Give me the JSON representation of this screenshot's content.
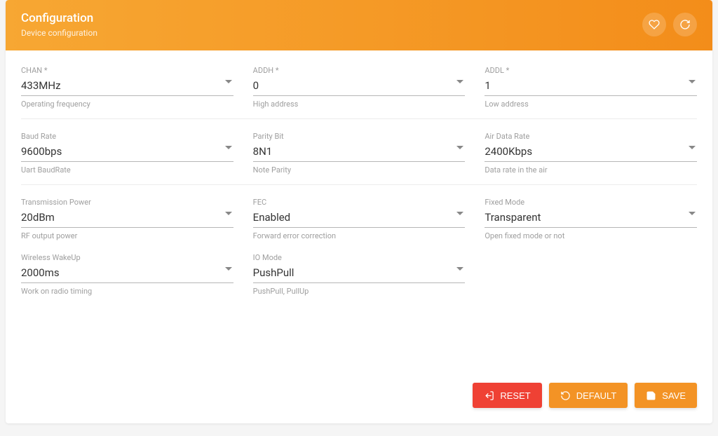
{
  "header": {
    "title": "Configuration",
    "subtitle": "Device configuration"
  },
  "fields": {
    "chan": {
      "label": "CHAN *",
      "value": "433MHz",
      "hint": "Operating frequency"
    },
    "addh": {
      "label": "ADDH *",
      "value": "0",
      "hint": "High address"
    },
    "addl": {
      "label": "ADDL *",
      "value": "1",
      "hint": "Low address"
    },
    "baud": {
      "label": "Baud Rate",
      "value": "9600bps",
      "hint": "Uart BaudRate"
    },
    "parity": {
      "label": "Parity Bit",
      "value": "8N1",
      "hint": "Note Parity"
    },
    "air": {
      "label": "Air Data Rate",
      "value": "2400Kbps",
      "hint": "Data rate in the air"
    },
    "txpwr": {
      "label": "Transmission Power",
      "value": "20dBm",
      "hint": "RF output power"
    },
    "fec": {
      "label": "FEC",
      "value": "Enabled",
      "hint": "Forward error correction"
    },
    "fixed": {
      "label": "Fixed Mode",
      "value": "Transparent",
      "hint": "Open fixed mode or not"
    },
    "wakeup": {
      "label": "Wireless WakeUp",
      "value": "2000ms",
      "hint": "Work on radio timing"
    },
    "iomode": {
      "label": "IO Mode",
      "value": "PushPull",
      "hint": "PushPull, PullUp"
    }
  },
  "buttons": {
    "reset": "RESET",
    "default": "DEFAULT",
    "save": "SAVE"
  }
}
